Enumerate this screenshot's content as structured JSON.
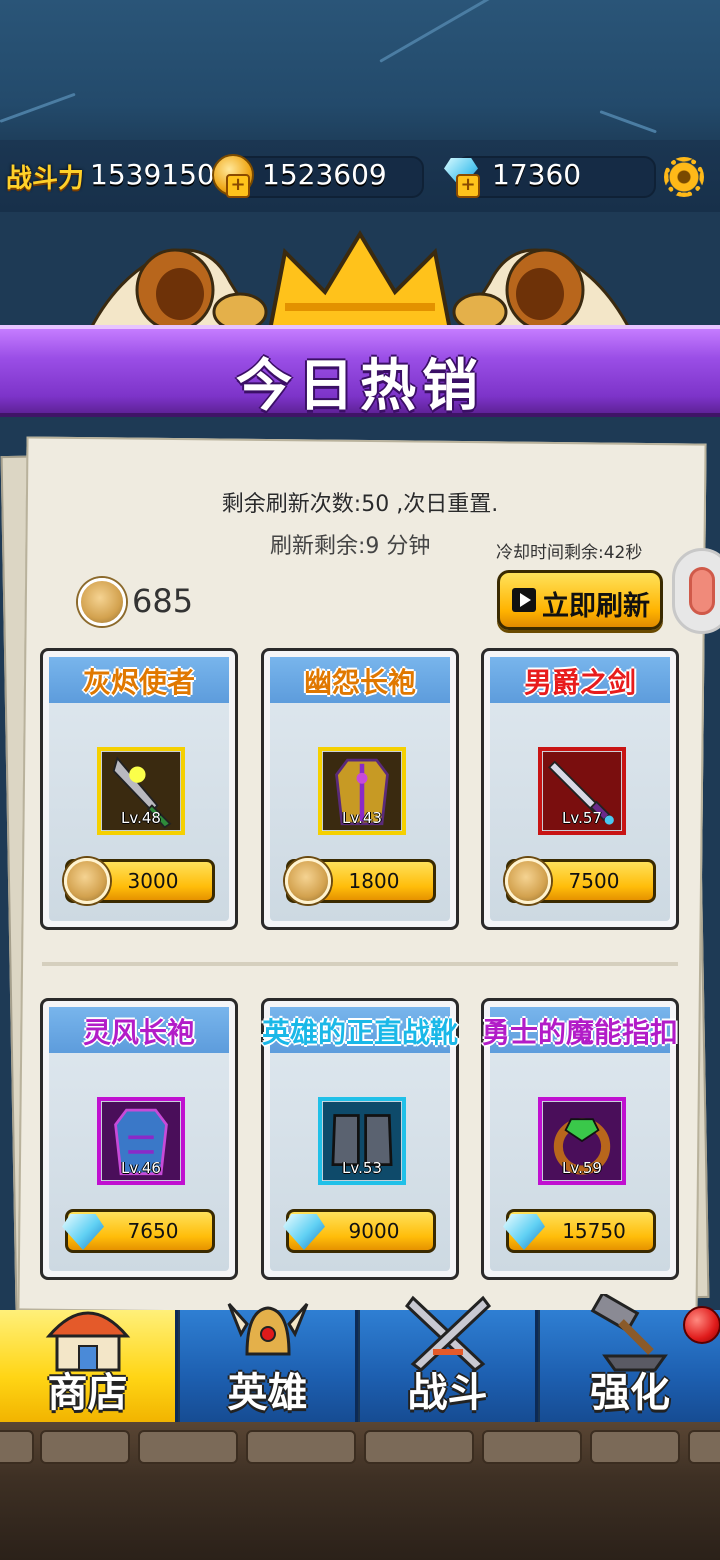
{
  "header": {
    "power_label": "战斗力",
    "power_value": "1539150",
    "gold_value": "1523609",
    "gem_value": "17360"
  },
  "banner": {
    "title": "今日热销"
  },
  "shop": {
    "refresh_info": "剩余刷新次数:50 ,次日重置.",
    "refresh_timer": "刷新剩余:9 分钟",
    "cooldown": "冷却时间剩余:42秒",
    "token_balance": "685",
    "refresh_button": "立即刷新",
    "items": [
      {
        "name": "灰烬使者",
        "level": "Lv.48",
        "price": "3000",
        "currency": "token",
        "name_color": "#e07800",
        "frame": "#f5d000"
      },
      {
        "name": "幽怨长袍",
        "level": "Lv.43",
        "price": "1800",
        "currency": "token",
        "name_color": "#e07800",
        "frame": "#f5d000"
      },
      {
        "name": "男爵之剑",
        "level": "Lv.57",
        "price": "7500",
        "currency": "token",
        "name_color": "#e81c1c",
        "frame": "#c81414"
      },
      {
        "name": "灵风长袍",
        "level": "Lv.46",
        "price": "7650",
        "currency": "gem",
        "name_color": "#b21cc8",
        "frame": "#c010d0"
      },
      {
        "name": "英雄的正直战靴",
        "level": "Lv.53",
        "price": "9000",
        "currency": "gem",
        "name_color": "#1ab8e8",
        "frame": "#20c0e8"
      },
      {
        "name": "勇士的魔能指扣",
        "level": "Lv.59",
        "price": "15750",
        "currency": "gem",
        "name_color": "#b21cc8",
        "frame": "#c010d0"
      }
    ]
  },
  "nav": {
    "tabs": [
      {
        "label": "商店",
        "icon": "shop-icon",
        "active": true
      },
      {
        "label": "英雄",
        "icon": "hero-helmet-icon",
        "active": false
      },
      {
        "label": "战斗",
        "icon": "crossed-swords-icon",
        "active": false
      },
      {
        "label": "强化",
        "icon": "hammer-anvil-icon",
        "active": false
      }
    ]
  },
  "colors": {
    "banner": "#9a4ee6",
    "accent_yellow": "#ffc21b",
    "nav_blue": "#1d5fb0"
  }
}
